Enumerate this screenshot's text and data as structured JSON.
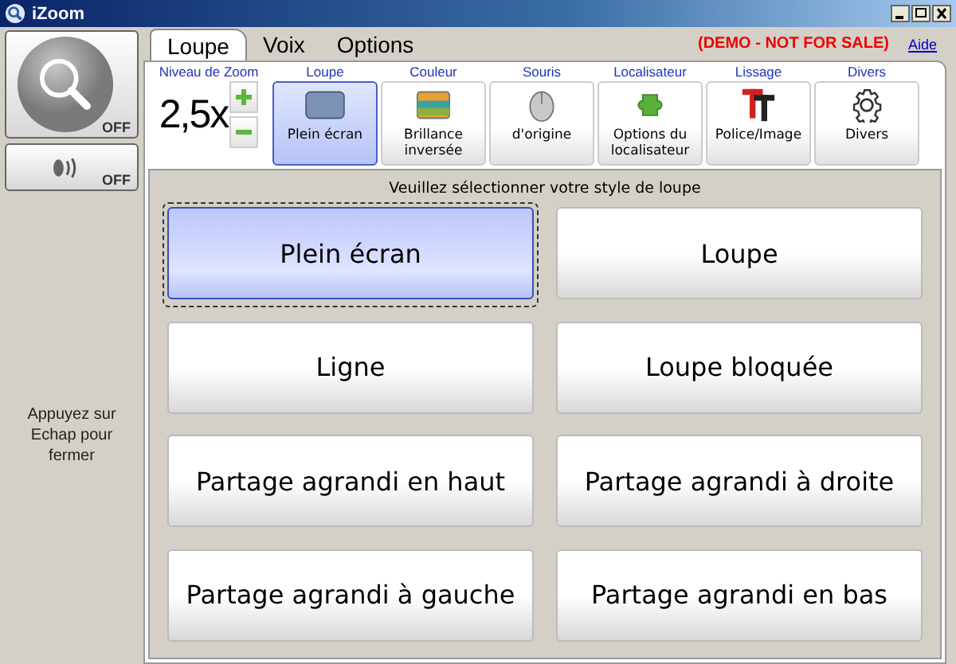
{
  "window": {
    "title": "iZoom"
  },
  "left_panel": {
    "magnifier_toggle": {
      "label": "OFF",
      "on": false
    },
    "speech_toggle": {
      "label": "OFF",
      "on": false
    },
    "hint": "Appuyez sur Echap pour fermer"
  },
  "tabs": [
    {
      "label": "Loupe",
      "selected": true
    },
    {
      "label": "Voix",
      "selected": false
    },
    {
      "label": "Options",
      "selected": false
    }
  ],
  "demo_notice": "(DEMO - NOT FOR SALE)",
  "help_link": "Aide",
  "zoom": {
    "header": "Niveau de Zoom",
    "value": "2,5x"
  },
  "tools": [
    {
      "header": "Loupe",
      "label": "Plein écran",
      "selected": true
    },
    {
      "header": "Couleur",
      "label": "Brillance inversée",
      "selected": false
    },
    {
      "header": "Souris",
      "label": "d'origine",
      "selected": false
    },
    {
      "header": "Localisateur",
      "label": "Options du localisateur",
      "selected": false
    },
    {
      "header": "Lissage",
      "label": "Police/Image",
      "selected": false
    },
    {
      "header": "Divers",
      "label": "Divers",
      "selected": false
    }
  ],
  "style_prompt": "Veuillez sélectionner votre style de loupe",
  "styles": [
    {
      "label": "Plein écran",
      "selected": true
    },
    {
      "label": "Loupe",
      "selected": false
    },
    {
      "label": "Ligne",
      "selected": false
    },
    {
      "label": "Loupe bloquée",
      "selected": false
    },
    {
      "label": "Partage agrandi en haut",
      "selected": false
    },
    {
      "label": "Partage agrandi à droite",
      "selected": false
    },
    {
      "label": "Partage agrandi à gauche",
      "selected": false
    },
    {
      "label": "Partage agrandi en bas",
      "selected": false
    }
  ]
}
